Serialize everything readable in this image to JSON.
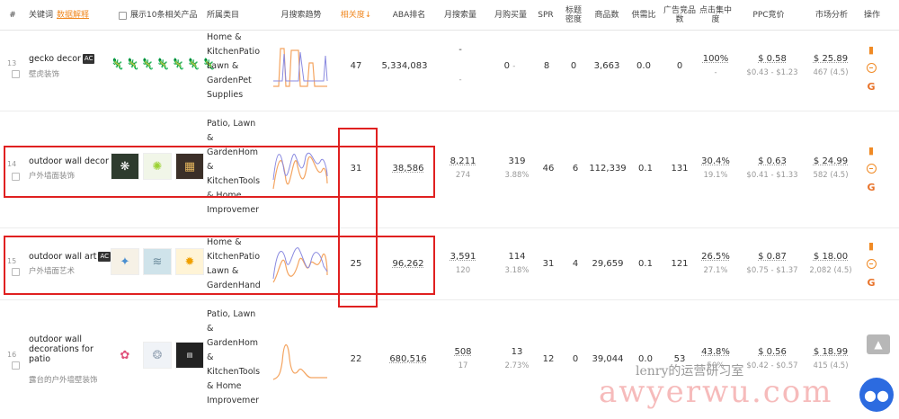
{
  "header": {
    "hash": "#",
    "keyword": "关键词",
    "data_explain": "数据解释",
    "show_products": "展示10条相关产品",
    "category": "所属类目",
    "search_trend": "月搜索趋势",
    "relevance": "相关度↓",
    "aba_rank": "ABA排名",
    "monthly_search": "月搜索量",
    "monthly_buy": "月购买量",
    "spr": "SPR",
    "title_density": "标题密度",
    "products": "商品数",
    "supply_ratio": "供需比",
    "ad_products": "广告竞品数",
    "click_concentration": "点击集中度",
    "ppc": "PPC竞价",
    "market_analysis": "市场分析",
    "action": "操作"
  },
  "rows": [
    {
      "index": "13",
      "keyword": "gecko decor",
      "badge": "AC",
      "keyword_zh": "壁虎装饰",
      "category": [
        "Home &",
        "KitchenPatio",
        "Lawn &",
        "GardenPet",
        "Supplies"
      ],
      "relevance": "47",
      "aba_rank": "5,334,083",
      "monthly_search": "-",
      "monthly_search_sub": "-",
      "monthly_buy": "0",
      "monthly_buy_sub": "-",
      "spr": "8",
      "title_density": "0",
      "products": "3,663",
      "supply_ratio": "0.0",
      "ad_products": "0",
      "click_pct": "100%",
      "click_sub": "-",
      "ppc": "$ 0.58",
      "ppc_range": "$0.43 - $1.23",
      "market_price": "$ 25.89",
      "market_sub": "467 (4.5)"
    },
    {
      "index": "14",
      "keyword": "outdoor wall decor",
      "badge": "",
      "keyword_zh": "户外墙面装饰",
      "category": [
        "Patio, Lawn",
        "&",
        "GardenHom",
        "&",
        "KitchenTools",
        "& Home",
        "Improvemer"
      ],
      "relevance": "31",
      "aba_rank": "38,586",
      "monthly_search": "8,211",
      "monthly_search_sub": "274",
      "monthly_buy": "319",
      "monthly_buy_sub": "3.88%",
      "spr": "46",
      "title_density": "6",
      "products": "112,339",
      "supply_ratio": "0.1",
      "ad_products": "131",
      "click_pct": "30.4%",
      "click_sub": "19.1%",
      "ppc": "$ 0.63",
      "ppc_range": "$0.41 - $1.33",
      "market_price": "$ 24.99",
      "market_sub": "582 (4.5)"
    },
    {
      "index": "15",
      "keyword": "outdoor wall art",
      "badge": "AC",
      "keyword_zh": "户外墙面艺术",
      "category": [
        "Home &",
        "KitchenPatio",
        "Lawn &",
        "GardenHand"
      ],
      "relevance": "25",
      "aba_rank": "96,262",
      "monthly_search": "3,591",
      "monthly_search_sub": "120",
      "monthly_buy": "114",
      "monthly_buy_sub": "3.18%",
      "spr": "31",
      "title_density": "4",
      "products": "29,659",
      "supply_ratio": "0.1",
      "ad_products": "121",
      "click_pct": "26.5%",
      "click_sub": "27.1%",
      "ppc": "$ 0.87",
      "ppc_range": "$0.75 - $1.37",
      "market_price": "$ 18.00",
      "market_sub": "2,082 (4.5)"
    },
    {
      "index": "16",
      "keyword": "outdoor wall decorations for patio",
      "keyword_lines": [
        "outdoor wall",
        "decorations for",
        "patio"
      ],
      "badge": "",
      "keyword_zh": "露台的户外墙壁装饰",
      "category": [
        "Patio, Lawn",
        "&",
        "GardenHom",
        "&",
        "KitchenTools",
        "& Home",
        "Improvemer"
      ],
      "relevance": "22",
      "aba_rank": "680,516",
      "monthly_search": "508",
      "monthly_search_sub": "17",
      "monthly_buy": "13",
      "monthly_buy_sub": "2.73%",
      "spr": "12",
      "title_density": "0",
      "products": "39,044",
      "supply_ratio": "0.0",
      "ad_products": "53",
      "click_pct": "43.8%",
      "click_sub": "50%",
      "ppc": "$ 0.56",
      "ppc_range": "$0.42 - $0.57",
      "market_price": "$ 18.99",
      "market_sub": "415 (4.5)"
    }
  ],
  "watermark": "lenry的运营研习室",
  "watermark_site": "awyerwu.com",
  "colors": {
    "accent": "#f08a24",
    "highlight": "#e02020",
    "chat": "#2c6be0"
  }
}
